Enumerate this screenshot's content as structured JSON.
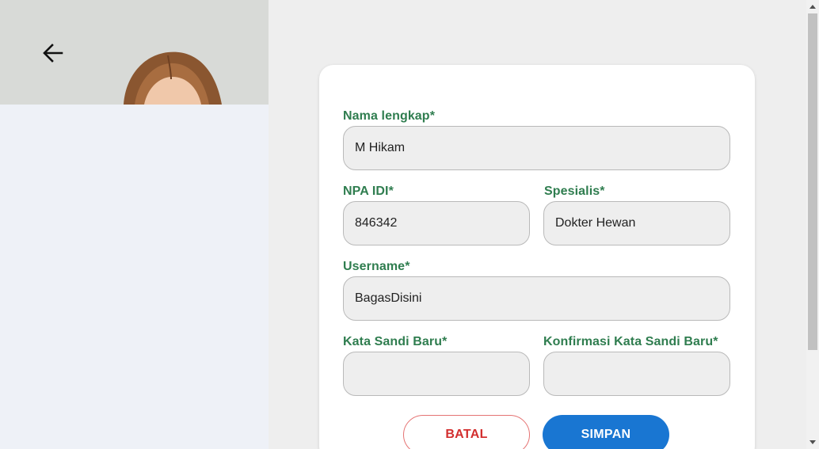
{
  "form": {
    "full_name": {
      "label": "Nama lengkap",
      "required_mark": "*",
      "value": "M Hikam"
    },
    "npa_idi": {
      "label": "NPA IDI",
      "required_mark": "*",
      "value": "846342"
    },
    "specialist": {
      "label": "Spesialis",
      "required_mark": "*",
      "value": "Dokter Hewan"
    },
    "username": {
      "label": "Username",
      "required_mark": "*",
      "value": "BagasDisini"
    },
    "new_password": {
      "label": "Kata Sandi Baru",
      "required_mark": "*",
      "value": ""
    },
    "confirm_password": {
      "label": "Konfirmasi Kata Sandi Baru",
      "required_mark": "*",
      "value": ""
    }
  },
  "buttons": {
    "cancel": "BATAL",
    "save": "SIMPAN"
  },
  "icons": {
    "back": "arrow-left-icon"
  },
  "colors": {
    "label_green": "#2f7d4f",
    "cancel_red": "#d32f2f",
    "save_blue": "#1976d2",
    "input_bg": "#eeeeee",
    "page_bg": "#eeeeee",
    "left_panel_bg": "#eef1f7"
  }
}
